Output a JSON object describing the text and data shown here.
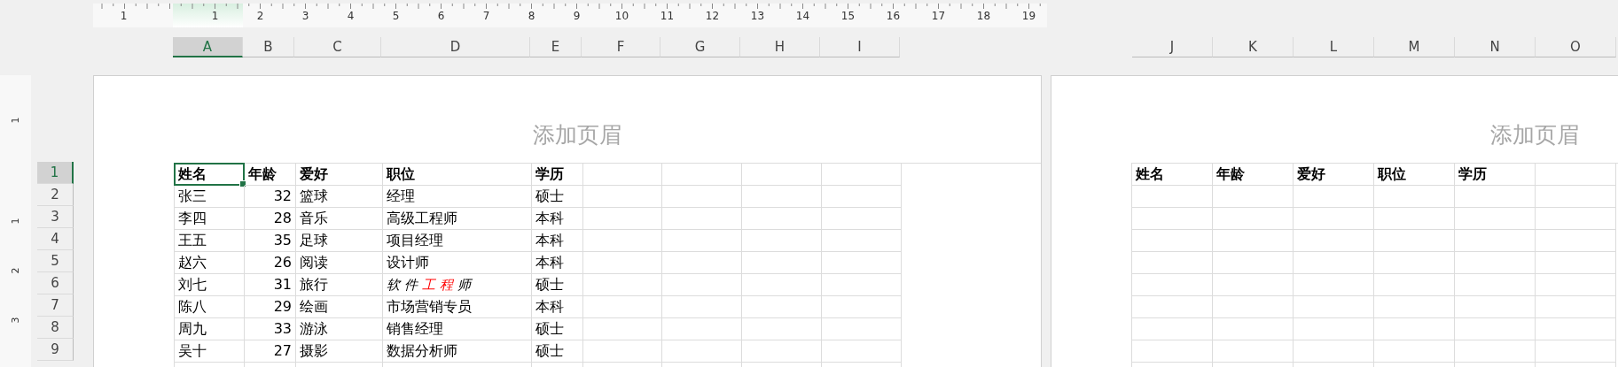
{
  "ruler": [
    "1",
    "1",
    "2",
    "3",
    "4",
    "5",
    "6",
    "7",
    "8",
    "9",
    "10",
    "11",
    "12",
    "13",
    "14",
    "15",
    "16",
    "17",
    "18",
    "19"
  ],
  "vertical_ruler": [
    "1",
    "1",
    "2",
    "3"
  ],
  "column_headers": [
    [
      {
        "label": "A",
        "selected": true
      },
      {
        "label": "B",
        "selected": false
      },
      {
        "label": "C",
        "selected": false
      },
      {
        "label": "D",
        "selected": false
      },
      {
        "label": "E",
        "selected": false
      },
      {
        "label": "F",
        "selected": false
      },
      {
        "label": "G",
        "selected": false
      },
      {
        "label": "H",
        "selected": false
      },
      {
        "label": "I",
        "selected": false
      }
    ],
    [
      {
        "label": "J",
        "selected": false
      },
      {
        "label": "K",
        "selected": false
      },
      {
        "label": "L",
        "selected": false
      },
      {
        "label": "M",
        "selected": false
      },
      {
        "label": "N",
        "selected": false
      },
      {
        "label": "O",
        "selected": false
      }
    ]
  ],
  "row_headers": [
    {
      "label": "1",
      "selected": true
    },
    {
      "label": "2",
      "selected": false
    },
    {
      "label": "3",
      "selected": false
    },
    {
      "label": "4",
      "selected": false
    },
    {
      "label": "5",
      "selected": false
    },
    {
      "label": "6",
      "selected": false
    },
    {
      "label": "7",
      "selected": false
    },
    {
      "label": "8",
      "selected": false
    },
    {
      "label": "9",
      "selected": false
    }
  ],
  "pages": [
    {
      "header_placeholder": "添加页眉",
      "table": {
        "columns": [
          {
            "label": "姓名",
            "right_aligned": false
          },
          {
            "label": "年龄",
            "right_aligned": true
          },
          {
            "label": "爱好",
            "right_aligned": false
          },
          {
            "label": "职位",
            "right_aligned": false
          },
          {
            "label": "学历",
            "right_aligned": false
          }
        ],
        "rows": [
          [
            "张三",
            "32",
            "篮球",
            "经理",
            "硕士"
          ],
          [
            "李四",
            "28",
            "音乐",
            "高级工程师",
            "本科"
          ],
          [
            "王五",
            "35",
            "足球",
            "项目经理",
            "本科"
          ],
          [
            "赵六",
            "26",
            "阅读",
            "设计师",
            "本科"
          ],
          [
            "刘七",
            "31",
            "旅行",
            {
              "kind": "calligraphy",
              "segments": [
                {
                  "text": "软件",
                  "color": "#000000"
                },
                {
                  "text": "工程",
                  "color": "#ff0000"
                },
                {
                  "text": "师",
                  "color": "#000000"
                }
              ]
            },
            "硕士"
          ],
          [
            "陈八",
            "29",
            "绘画",
            "市场营销专员",
            "本科"
          ],
          [
            "周九",
            "33",
            "游泳",
            "销售经理",
            "硕士"
          ],
          [
            "吴十",
            "27",
            "摄影",
            "数据分析师",
            "硕士"
          ]
        ]
      }
    },
    {
      "header_placeholder": "添加页眉",
      "table": {
        "columns": [
          {
            "label": "姓名"
          },
          {
            "label": "年龄"
          },
          {
            "label": "爱好"
          },
          {
            "label": "职位"
          },
          {
            "label": "学历"
          }
        ]
      }
    }
  ]
}
